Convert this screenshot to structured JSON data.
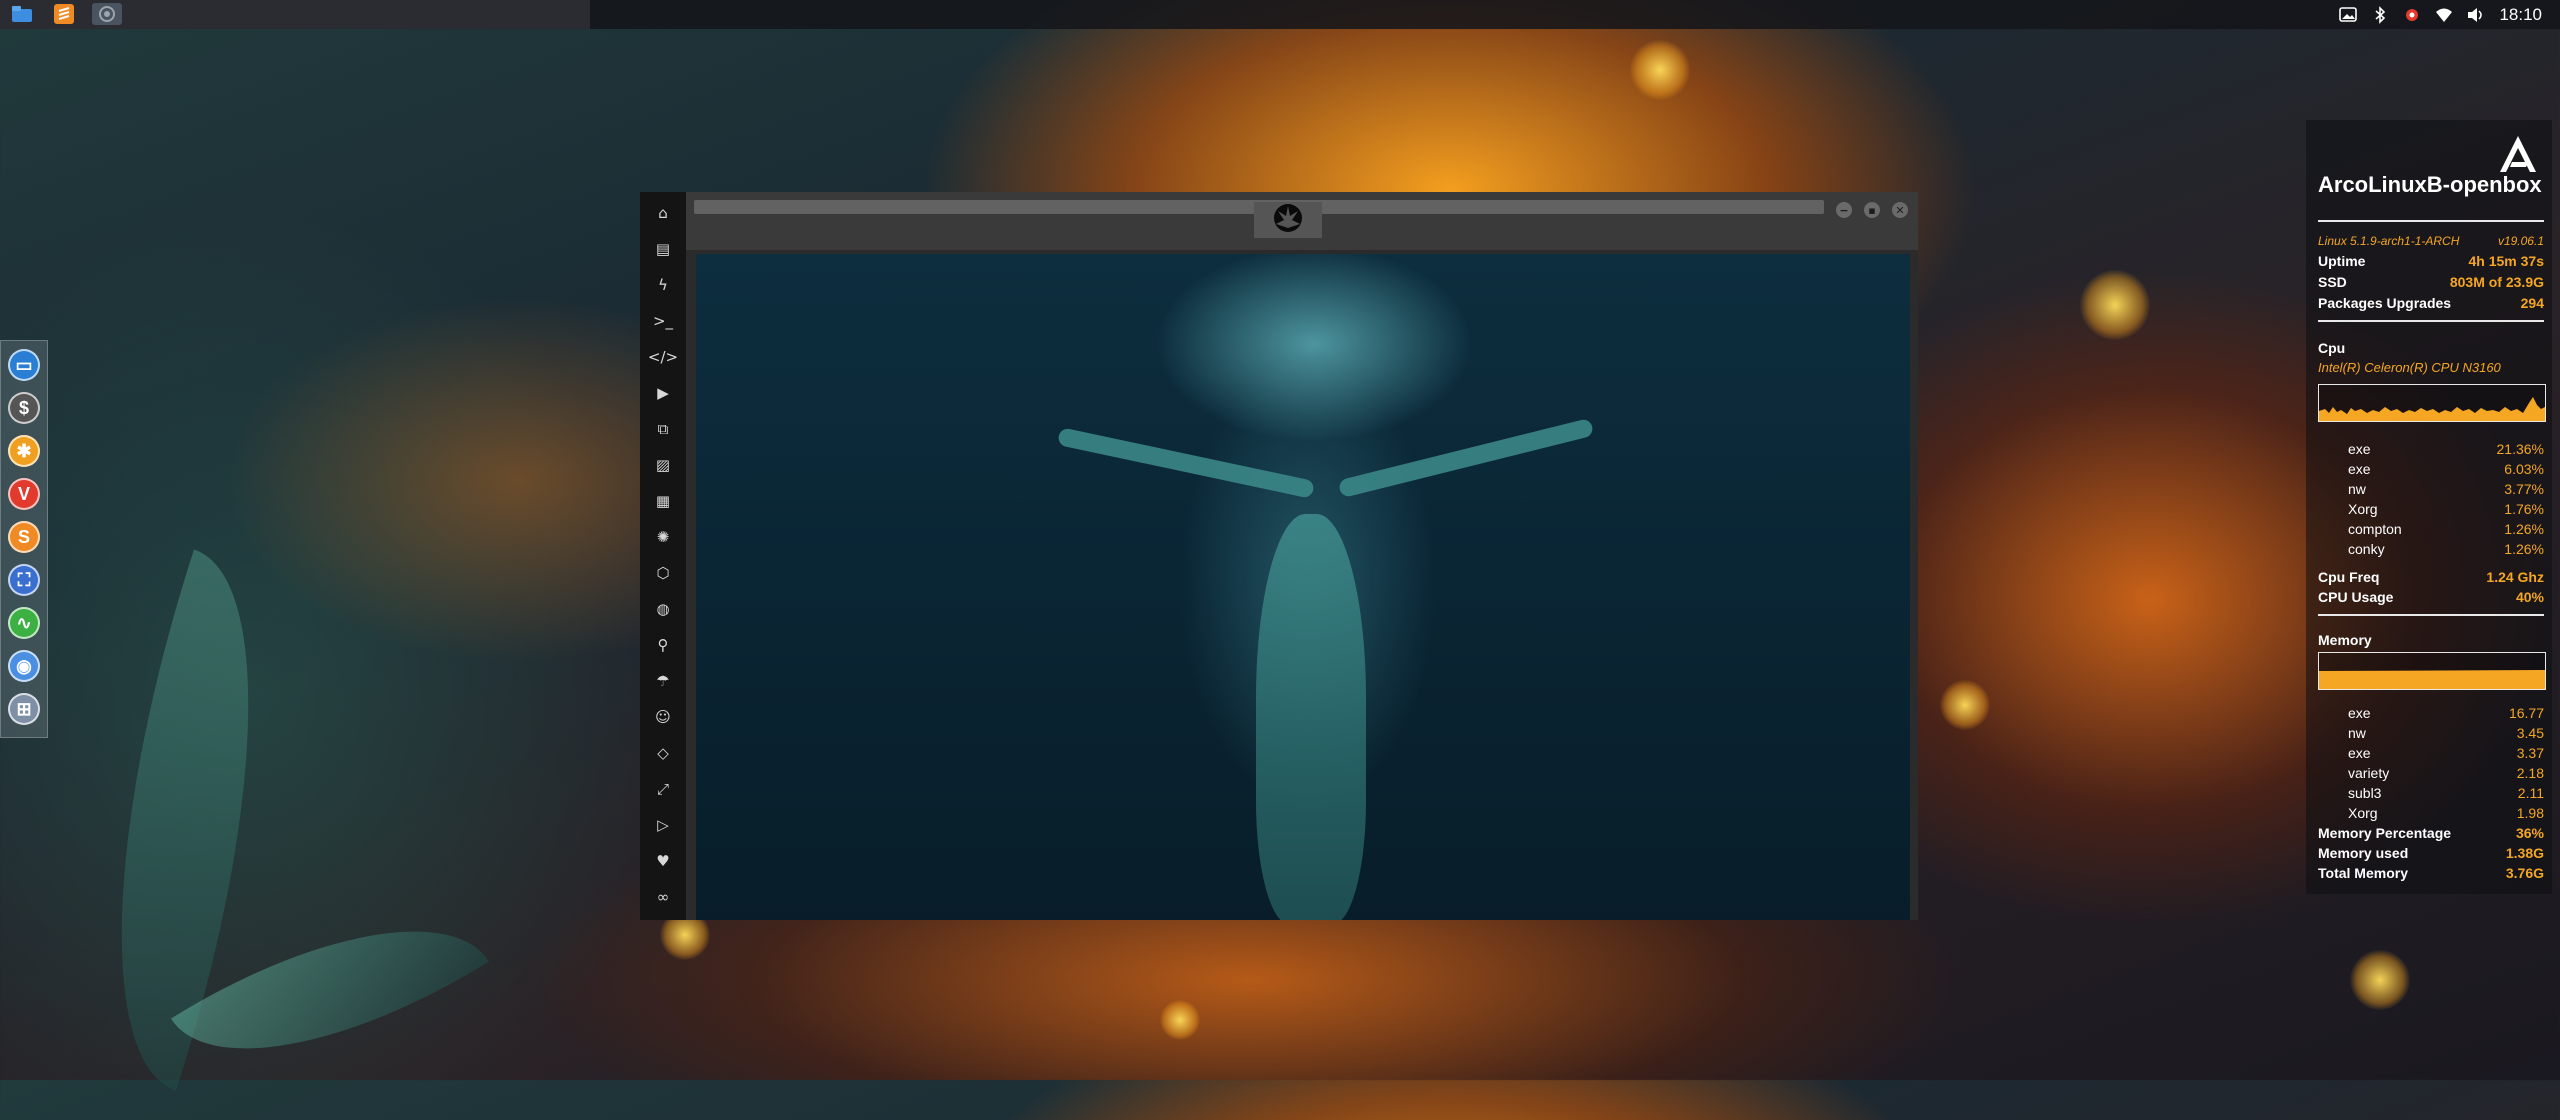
{
  "top_panel": {
    "clock": "18:10",
    "launchers": [
      {
        "name": "file-manager-icon",
        "color": "#3d8ee0"
      },
      {
        "name": "sublime-text-icon",
        "color": "#f08a24"
      },
      {
        "name": "settings-icon",
        "color": "#8a8a8a"
      }
    ],
    "tray": [
      "image-viewer-icon",
      "bluetooth-icon",
      "update-notifier-icon",
      "wifi-icon",
      "volume-icon"
    ]
  },
  "dock": {
    "apps": [
      {
        "name": "file-manager-dock-icon",
        "glyph": "▭",
        "color": "#2a7fd4"
      },
      {
        "name": "terminal-dock-icon",
        "glyph": "$",
        "color": "#555555"
      },
      {
        "name": "system-settings-dock-icon",
        "glyph": "✱",
        "color": "#f0a020"
      },
      {
        "name": "vivaldi-dock-icon",
        "glyph": "V",
        "color": "#e23b2e"
      },
      {
        "name": "sublime-dock-icon",
        "glyph": "S",
        "color": "#f08a24"
      },
      {
        "name": "screenshot-dock-icon",
        "glyph": "⛶",
        "color": "#3a6fd0"
      },
      {
        "name": "system-monitor-dock-icon",
        "glyph": "∿",
        "color": "#3cb043"
      },
      {
        "name": "chromium-dock-icon",
        "glyph": "◉",
        "color": "#4a8fe0"
      },
      {
        "name": "workspace-grid-dock-icon",
        "glyph": "⊞",
        "color": "#7f8fa6"
      }
    ]
  },
  "browser": {
    "sidebar_icons": [
      {
        "name": "home-icon",
        "glyph": "⌂"
      },
      {
        "name": "document-icon",
        "glyph": "▤"
      },
      {
        "name": "lightning-icon",
        "glyph": "ϟ"
      },
      {
        "name": "terminal-icon",
        "glyph": ">_"
      },
      {
        "name": "code-icon",
        "glyph": "</>"
      },
      {
        "name": "play-icon",
        "glyph": "▶"
      },
      {
        "name": "copy-icon",
        "glyph": "⧉"
      },
      {
        "name": "image-icon",
        "glyph": "▨"
      },
      {
        "name": "news-icon",
        "glyph": "▦"
      },
      {
        "name": "settings-icon",
        "glyph": "✺"
      },
      {
        "name": "hexagon-icon",
        "glyph": "⬡"
      },
      {
        "name": "globe-icon",
        "glyph": "◍"
      },
      {
        "name": "search-icon",
        "glyph": "⚲"
      },
      {
        "name": "umbrella-icon",
        "glyph": "☂"
      },
      {
        "name": "contact-icon",
        "glyph": "☺"
      },
      {
        "name": "code-diamond-icon",
        "glyph": "◇"
      },
      {
        "name": "fullscreen-icon",
        "glyph": "⤢"
      },
      {
        "name": "youtube-icon",
        "glyph": "▷"
      },
      {
        "name": "heart-icon",
        "glyph": "♥"
      },
      {
        "name": "link-icon",
        "glyph": "∞"
      }
    ],
    "tab_icon": "rebel-alliance-icon",
    "controls": [
      "−",
      "▪",
      "✕"
    ]
  },
  "conky": {
    "hostname": "ArcoLinuxB-openbox",
    "kernel": "Linux 5.1.9-arch1-1-ARCH",
    "version": "v19.06.1",
    "uptime_label": "Uptime",
    "uptime": "4h 15m 37s",
    "ssd_label": "SSD",
    "ssd": "803M of 23.9G",
    "packages_label": "Packages Upgrades",
    "packages": "294",
    "cpu_title": "Cpu",
    "cpu_name": "Intel(R) Celeron(R) CPU  N3160",
    "cpu_processes": [
      {
        "name": "exe",
        "value": "21.36%"
      },
      {
        "name": "exe",
        "value": "6.03%"
      },
      {
        "name": "nw",
        "value": "3.77%"
      },
      {
        "name": "Xorg",
        "value": "1.76%"
      },
      {
        "name": "compton",
        "value": "1.26%"
      },
      {
        "name": "conky",
        "value": "1.26%"
      }
    ],
    "cpu_freq_label": "Cpu Freq",
    "cpu_freq": "1.24 Ghz",
    "cpu_usage_label": "CPU Usage",
    "cpu_usage": "40%",
    "memory_title": "Memory",
    "memory_processes": [
      {
        "name": "exe",
        "value": "16.77"
      },
      {
        "name": "nw",
        "value": "3.45"
      },
      {
        "name": "exe",
        "value": "3.37"
      },
      {
        "name": "variety",
        "value": "2.18"
      },
      {
        "name": "subl3",
        "value": "2.11"
      },
      {
        "name": "Xorg",
        "value": "1.98"
      }
    ],
    "mem_pct_label": "Memory Percentage",
    "mem_pct": "36%",
    "mem_used_label": "Memory used",
    "mem_used": "1.38G",
    "total_mem_label": "Total Memory",
    "total_mem": "3.76G",
    "accent": "#f5a623"
  }
}
